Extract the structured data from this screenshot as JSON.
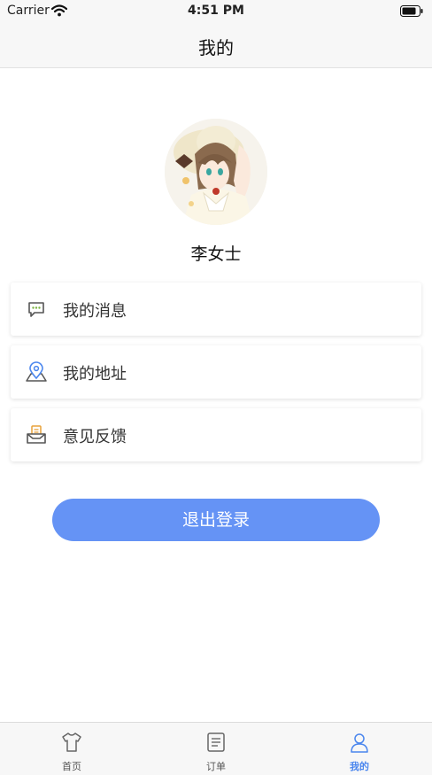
{
  "status_bar": {
    "carrier": "Carrier",
    "time": "4:51 PM"
  },
  "nav": {
    "title": "我的"
  },
  "profile": {
    "name": "李女士"
  },
  "menu": {
    "items": [
      {
        "label": "我的消息",
        "icon": "message-icon"
      },
      {
        "label": "我的地址",
        "icon": "location-icon"
      },
      {
        "label": "意见反馈",
        "icon": "feedback-icon"
      }
    ]
  },
  "logout": {
    "label": "退出登录"
  },
  "tab_bar": {
    "tabs": [
      {
        "label": "首页",
        "icon": "shirt-icon",
        "active": false
      },
      {
        "label": "订单",
        "icon": "order-icon",
        "active": false
      },
      {
        "label": "我的",
        "icon": "user-icon",
        "active": true
      }
    ]
  },
  "colors": {
    "accent": "#6593f5",
    "active_tab": "#4a86ee",
    "bar_background": "#f7f7f7"
  }
}
